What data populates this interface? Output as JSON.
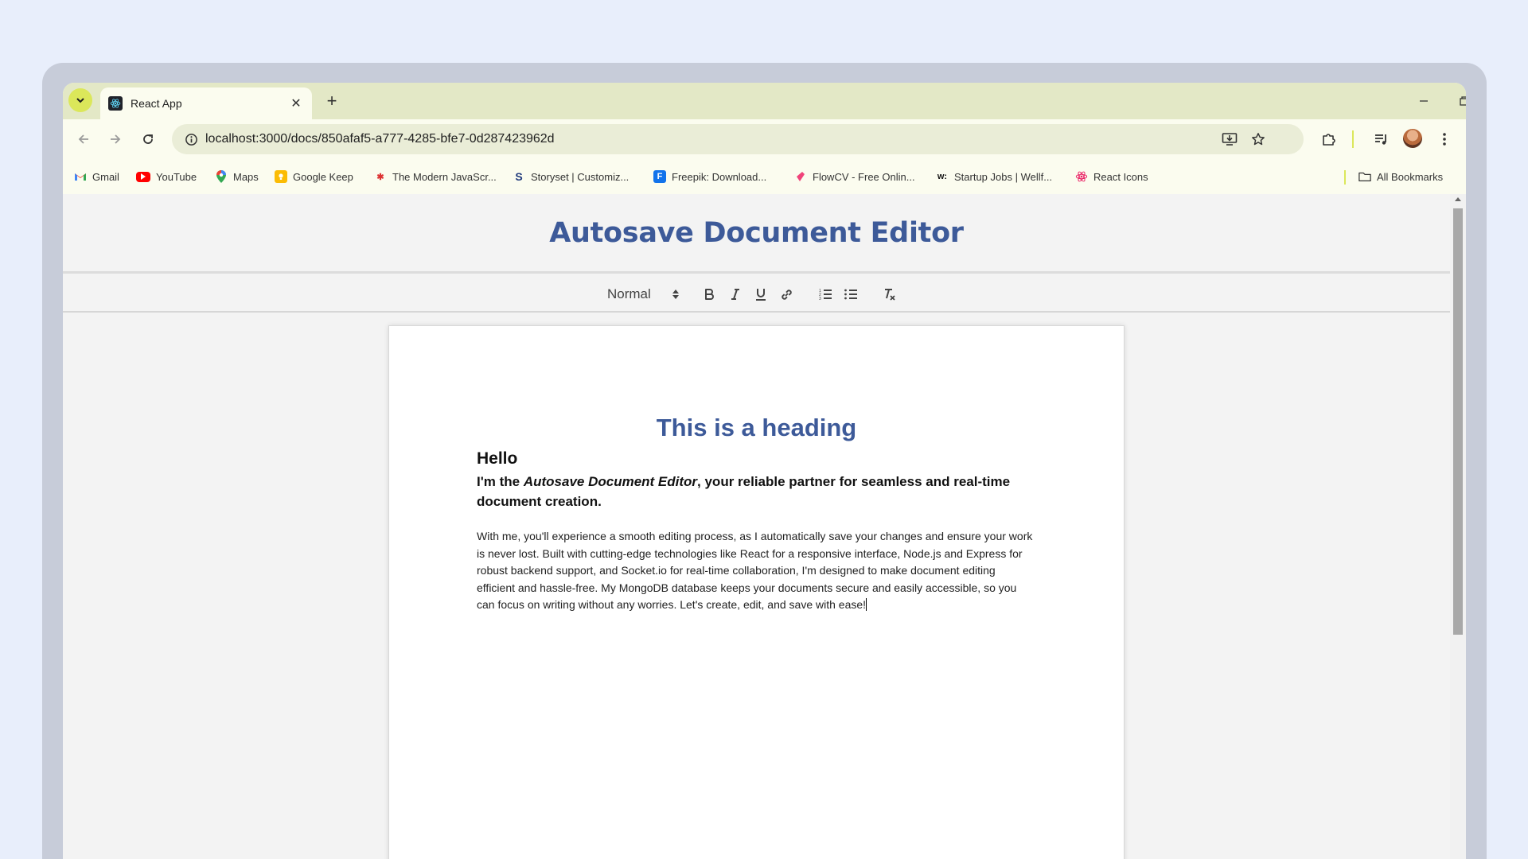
{
  "browser": {
    "tab_title": "React App",
    "url": "localhost:3000/docs/850afaf5-a777-4285-bfe7-0d287423962d",
    "bookmarks": [
      {
        "label": "Gmail",
        "icon": "gmail-icon"
      },
      {
        "label": "YouTube",
        "icon": "youtube-icon"
      },
      {
        "label": "Maps",
        "icon": "maps-icon"
      },
      {
        "label": "Google Keep",
        "icon": "keep-icon"
      },
      {
        "label": "The Modern JavaScr...",
        "icon": "javascript-info-icon"
      },
      {
        "label": "Storyset | Customiz...",
        "icon": "storyset-icon"
      },
      {
        "label": "Freepik: Download...",
        "icon": "freepik-icon"
      },
      {
        "label": "FlowCV - Free Onlin...",
        "icon": "flowcv-icon"
      },
      {
        "label": "Startup Jobs | Wellf...",
        "icon": "wellfound-icon"
      },
      {
        "label": "React Icons",
        "icon": "react-icon"
      }
    ],
    "all_bookmarks": "All Bookmarks"
  },
  "app": {
    "title": "Autosave Document Editor"
  },
  "toolbar": {
    "header_format": "Normal",
    "buttons": [
      "bold-icon",
      "italic-icon",
      "underline-icon",
      "link-icon",
      "ordered-list-icon",
      "bullet-list-icon",
      "clear-format-icon"
    ]
  },
  "document": {
    "heading": "This is a heading",
    "hello": "Hello",
    "intro_prefix": "I'm the ",
    "intro_emphasis": "Autosave Document Editor",
    "intro_suffix": ", your reliable partner for seamless and real-time document creation.",
    "body": "With me, you'll experience a smooth editing process, as I automatically save your changes and ensure your work is never lost. Built with cutting-edge technologies like React for a responsive interface, Node.js and Express for robust backend support, and Socket.io for real-time collaboration, I'm designed to make document editing efficient and hassle-free. My MongoDB database keeps your documents secure and easily accessible, so you can focus on writing without any worries. Let's create, edit, and save with ease!"
  },
  "colors": {
    "accent": "#3d5a99",
    "tabstrip": "#e3e8c6",
    "toolbar": "#fbfcef",
    "background": "#e8eefb"
  }
}
